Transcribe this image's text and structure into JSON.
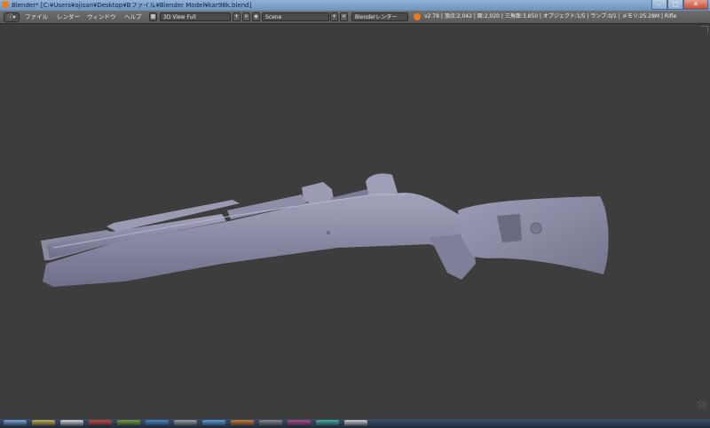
{
  "window": {
    "title": "Blender* [C:¥Users¥ojisan¥Desktop¥Bファイル¥Blender Model¥kar98k.blend]",
    "controls": {
      "minimize": "–",
      "maximize": "□",
      "close": "✕"
    }
  },
  "header": {
    "editor_icon": "info-editor-icon",
    "menus": [
      "ファイル",
      "レンダー",
      "ウィンドウ",
      "ヘルプ"
    ],
    "screen_layout": "3D View Full",
    "scene": "Scene",
    "render_engine": "Blenderレンダー",
    "stats": "v2.78 | 頂点:2,042 | 面:2,020 | 三角面:3,850 | オブジェクト:1/5 | ランプ:0/1 | メモリ:25.28M | Rifle"
  },
  "viewport": {
    "background": "#3d3d3d",
    "object_color": "#8e8ea8"
  },
  "taskbar": {
    "items": [
      "#7aa7d9",
      "#c9b24a",
      "#d6d6d6",
      "#c44a3a",
      "#7a9c3a",
      "#4a86c8",
      "#9e9e9e",
      "#5aa0d8",
      "#d07a2a",
      "#8a8a8a",
      "#b04a8a",
      "#4ab0a0",
      "#d0d0d0"
    ]
  }
}
